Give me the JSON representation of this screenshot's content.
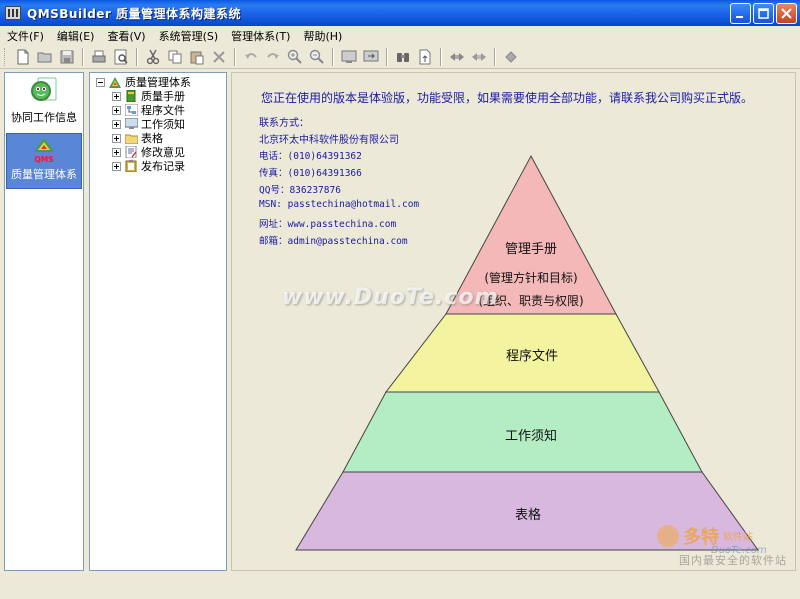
{
  "window": {
    "title": "QMSBuilder 质量管理体系构建系统"
  },
  "menu": [
    {
      "label": "文件(F)"
    },
    {
      "label": "编辑(E)"
    },
    {
      "label": "查看(V)"
    },
    {
      "label": "系统管理(S)"
    },
    {
      "label": "管理体系(T)"
    },
    {
      "label": "帮助(H)"
    }
  ],
  "toolbar": {
    "icons": [
      "new-icon",
      "open-icon",
      "save-icon",
      "print-icon",
      "preview-icon",
      "cut-icon",
      "copy-icon",
      "paste-icon",
      "delete-icon",
      "undo-icon",
      "redo-icon",
      "zoom-in-icon",
      "zoom-out-icon",
      "screen-icon",
      "screen-arrow-icon",
      "find-icon",
      "export-icon",
      "arrows-left-icon",
      "arrows-right-icon",
      "diamond-icon"
    ]
  },
  "nav": {
    "items": [
      {
        "label": "协同工作信息",
        "icon": "collab-icon"
      },
      {
        "label": "质量管理体系",
        "icon": "qms-icon",
        "logo_text": "QMS",
        "active": true
      }
    ]
  },
  "tree": {
    "root": "质量管理体系",
    "children": [
      "质量手册",
      "程序文件",
      "工作须知",
      "表格",
      "修改意见",
      "发布记录"
    ]
  },
  "content": {
    "notice": "您正在使用的版本是体验版，功能受限，如果需要使用全部功能，请联系我公司购买正式版。",
    "contact": {
      "heading": "联系方式：",
      "company": "北京环太中科软件股份有限公司",
      "phone": "电话：(010)64391362",
      "fax": "传真：(010)64391366",
      "qq": "QQ号：836237876",
      "msn": "MSN:  passtechina@hotmail.com",
      "web": "网址：www.passtechina.com",
      "email": "邮箱：admin@passtechina.com"
    },
    "pyramid": {
      "levels": [
        {
          "title": "管理手册",
          "lines": [
            "(管理方针和目标)",
            "(组织、职责与权限)"
          ],
          "color": "#f4b8b8"
        },
        {
          "title": "程序文件",
          "lines": [],
          "color": "#f4f4a0"
        },
        {
          "title": "工作须知",
          "lines": [],
          "color": "#b4ecc4"
        },
        {
          "title": "表格",
          "lines": [],
          "color": "#d9b8e0"
        }
      ]
    }
  },
  "watermark": {
    "site": "www.DuoTe.com",
    "logo_main": "多特",
    "logo_sub": "软件站",
    "logo_url": "DuoTe.com",
    "caption": "国内最安全的软件站"
  }
}
